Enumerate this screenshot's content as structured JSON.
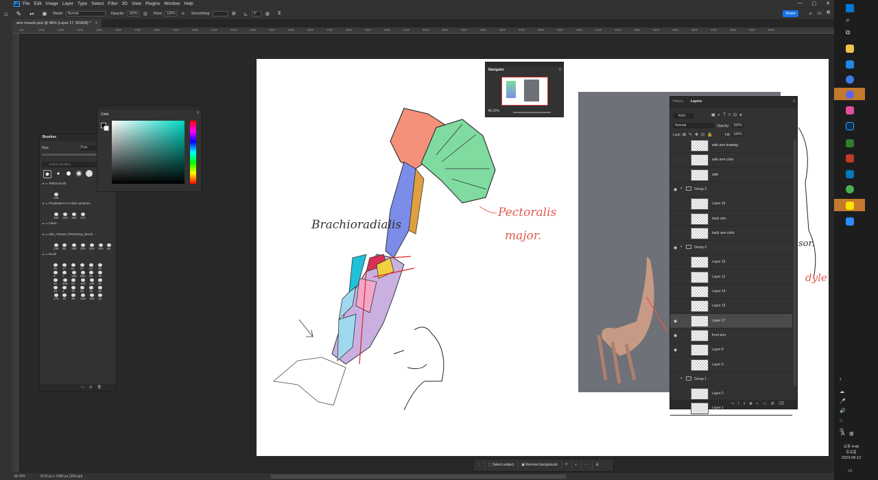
{
  "app": {
    "logo": "Ps",
    "menu": [
      "File",
      "Edit",
      "Image",
      "Layer",
      "Type",
      "Select",
      "Filter",
      "3D",
      "View",
      "Plugins",
      "Window",
      "Help"
    ],
    "win_controls": [
      "—",
      "▢",
      "✕"
    ]
  },
  "options_bar": {
    "mode_label": "Mode:",
    "mode_value": "Normal",
    "opacity_label": "Opacity:",
    "opacity_value": "100%",
    "flow_label": "Flow:",
    "flow_value": "100%",
    "smoothing_label": "Smoothing:",
    "angle_value": "0°",
    "share_label": "Share"
  },
  "document": {
    "tab_title": "arm muscle.psd @ 48% (Layer 17, RGB/8) *",
    "zoom": "48.03%",
    "dims": "4120 px x 2480 px (300 ppi)"
  },
  "ruler_ticks": [
    "100",
    "1200",
    "1300",
    "1400",
    "1500",
    "1600",
    "1700",
    "1800",
    "1900",
    "2000",
    "2100",
    "2200",
    "2300",
    "2400",
    "2500",
    "2600",
    "2700",
    "2800",
    "2900",
    "3000",
    "3100",
    "3200",
    "3300",
    "3400",
    "3500",
    "3600",
    "3700",
    "3800",
    "3900",
    "4000",
    "4100",
    "4200",
    "4300",
    "4400",
    "4500",
    "4600",
    "4700",
    "4800",
    "4900",
    "5000"
  ],
  "color_panel": {
    "title": "Color"
  },
  "brushes_panel": {
    "title": "Brushes",
    "size_label": "Size",
    "size_value": "8 px",
    "search_placeholder": "Search Brushes",
    "groups": [
      {
        "name": "Tilt/hai brush",
        "nums": [
          "105"
        ]
      },
      {
        "name": "Pinakkaterra 3 Fabric Brushes",
        "nums": [
          "150",
          "150",
          "150",
          "174"
        ]
      },
      {
        "name": "Fabric",
        "nums": []
      },
      {
        "name": "Skin_Texture_Photoshop_Brush...",
        "nums": [
          "330",
          "95",
          "180",
          "200",
          "200",
          "100",
          "56"
        ]
      },
      {
        "name": "brush",
        "nums": [
          "25",
          "17",
          "61",
          "37",
          "23",
          "30",
          "5",
          "7",
          "150",
          "500",
          "25",
          "75",
          "25",
          "405",
          "92",
          "123",
          "100",
          "32",
          "40",
          "4",
          "78",
          "50",
          "10",
          "29",
          "175",
          "70",
          "38",
          "340",
          "100",
          "13"
        ]
      }
    ]
  },
  "navigator": {
    "title": "Navigator",
    "zoom": "48.03%"
  },
  "layers_panel": {
    "tabs": [
      "History",
      "Layers"
    ],
    "kind_label": "Kind",
    "blend_mode": "Normal",
    "opacity_label": "Opacity:",
    "opacity_value": "100%",
    "lock_label": "Lock:",
    "fill_label": "Fill:",
    "fill_value": "100%",
    "rows": [
      {
        "name": "side arm drawing",
        "type": "layer",
        "visible": false
      },
      {
        "name": "side arm color",
        "type": "layer",
        "visible": false
      },
      {
        "name": "side",
        "type": "layer",
        "visible": false
      },
      {
        "name": "Group 3",
        "type": "group",
        "visible": true
      },
      {
        "name": "Layer 16",
        "type": "layer",
        "visible": false
      },
      {
        "name": "back arm",
        "type": "layer",
        "visible": false
      },
      {
        "name": "back arm color",
        "type": "layer",
        "visible": false
      },
      {
        "name": "Group 2",
        "type": "group",
        "visible": true
      },
      {
        "name": "Layer 15",
        "type": "layer",
        "visible": false
      },
      {
        "name": "Layer 12",
        "type": "layer",
        "visible": false
      },
      {
        "name": "Layer 14",
        "type": "layer",
        "visible": false
      },
      {
        "name": "Layer 13",
        "type": "layer",
        "visible": false
      },
      {
        "name": "Layer 17",
        "type": "layer",
        "visible": true,
        "selected": true
      },
      {
        "name": "front arm",
        "type": "layer",
        "visible": true
      },
      {
        "name": "Layer 8",
        "type": "layer",
        "visible": true
      },
      {
        "name": "Layer 3",
        "type": "layer",
        "visible": false
      },
      {
        "name": "Group 1",
        "type": "group",
        "visible": false
      },
      {
        "name": "Layer 2",
        "type": "layer",
        "visible": false
      },
      {
        "name": "Layer 1",
        "type": "layer",
        "visible": false
      }
    ],
    "footer_icons": [
      "link-icon",
      "fx-icon",
      "mask-icon",
      "adjustment-icon",
      "folder-icon",
      "new-layer-icon",
      "trash-icon"
    ]
  },
  "canvas_text": {
    "brachioradialis": "Brachioradialis",
    "pectoralis": "Pectoralis",
    "major": "major.",
    "partial1": "dyle",
    "partial2": "sor."
  },
  "contextual_bar": {
    "select_subject": "Select subject",
    "remove_background": "Remove background"
  },
  "taskbar": {
    "time": "오후 4:40",
    "day": "토요일",
    "date": "2023-08-12",
    "ime": "A"
  },
  "colors": {
    "accent": "#1473e6",
    "panel_bg": "#323232",
    "canvas_bg": "#ffffff",
    "annotation_red": "#e05a4f"
  }
}
